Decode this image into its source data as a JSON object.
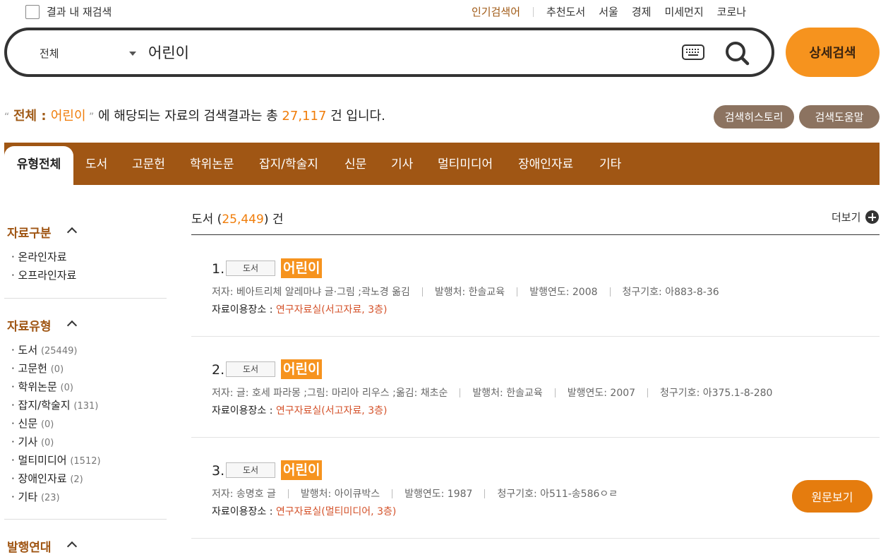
{
  "top_bar": {
    "recheck_label": "결과 내 재검색",
    "popular_label": "인기검색어",
    "keywords": [
      "추천도서",
      "서울",
      "경제",
      "미세먼지",
      "코로나"
    ]
  },
  "search": {
    "scope": "전체",
    "query": "어린이",
    "detail_button": "상세검색",
    "keyboard_icon": "keyboard-icon",
    "search_icon": "search-icon"
  },
  "summary": {
    "open_quote": "“",
    "scope": "전체",
    "colon": " : ",
    "keyword": "어린이",
    "close_quote": " ”",
    "text_before": " 에 해당되는 자료의 검색결과는 총 ",
    "total": "27,117",
    "text_after": " 건 입니다.",
    "history_button": "검색히스토리",
    "help_button": "검색도움말"
  },
  "tabs": [
    "유형전체",
    "도서",
    "고문헌",
    "학위논문",
    "잡지/학술지",
    "신문",
    "기사",
    "멀티미디어",
    "장애인자료",
    "기타"
  ],
  "active_tab": "유형전체",
  "sidebar": {
    "section1": {
      "title": "자료구분",
      "items": [
        "온라인자료",
        "오프라인자료"
      ]
    },
    "section2": {
      "title": "자료유형",
      "items": [
        {
          "label": "도서",
          "count": "(25449)"
        },
        {
          "label": "고문헌",
          "count": "(0)"
        },
        {
          "label": "학위논문",
          "count": "(0)"
        },
        {
          "label": "잡지/학술지",
          "count": "(131)"
        },
        {
          "label": "신문",
          "count": "(0)"
        },
        {
          "label": "기사",
          "count": "(0)"
        },
        {
          "label": "멀티미디어",
          "count": "(1512)"
        },
        {
          "label": "장애인자료",
          "count": "(2)"
        },
        {
          "label": "기타",
          "count": "(23)"
        }
      ]
    },
    "section3": {
      "title": "발행연대"
    }
  },
  "results_section": {
    "label": "도서",
    "open_paren": " (",
    "count": "25,449",
    "close_text": ") 건",
    "more_label": "더보기"
  },
  "results": [
    {
      "index": "1.",
      "badge": "도서",
      "title": "어린이",
      "author": "저자: 베아트리체 알레마냐 글·그림 ;곽노경 옮김",
      "publisher": "발행처: 한솔교육",
      "year": "발행연도: 2008",
      "call_no": "청구기호: 아883-8-36",
      "loc_label": "자료이용장소 : ",
      "loc_place": "연구자료실(서고자료, 3층)"
    },
    {
      "index": "2.",
      "badge": "도서",
      "title": "어린이",
      "author": "저자: 글: 호세 파라몽 ;그림: 마리아 리우스 ;옮김: 채초순",
      "publisher": "발행처: 한솔교육",
      "year": "발행연도: 2007",
      "call_no": "청구기호: 아375.1-8-280",
      "loc_label": "자료이용장소 : ",
      "loc_place": "연구자료실(서고자료, 3층)"
    },
    {
      "index": "3.",
      "badge": "도서",
      "title": "어린이",
      "author": "저자: 송명호 글",
      "publisher": "발행처: 아이큐박스",
      "year": "발행연도: 1987",
      "call_no": "청구기호: 아511-송586ㅇㄹ",
      "loc_label": "자료이용장소 : ",
      "loc_place": "연구자료실(멀티미디어, 3층)",
      "original_button": "원문보기"
    }
  ]
}
